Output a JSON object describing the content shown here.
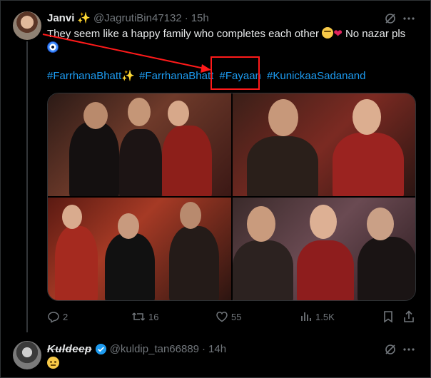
{
  "tweet": {
    "display_name": "Janvi",
    "name_emoji": "✨",
    "handle": "@JagrutiBin47132",
    "separator": "·",
    "time": "15h",
    "text": "They seem like a happy family who completes each other",
    "text_tail": "No nazar pls",
    "hashtags": [
      "#FarrhanaBhatt",
      "#FarrhanaBhatt",
      "#Fayaan",
      "#KunickaaSadanand"
    ],
    "highlighted_hashtag": "#Fayaan",
    "actions": {
      "replies": "2",
      "reposts": "16",
      "likes": "55",
      "views": "1.5K"
    }
  },
  "reply": {
    "display_name": "Kuldeep",
    "handle": "@kuldip_tan66889",
    "separator": "·",
    "time": "14h"
  },
  "colors": {
    "link": "#1d9bf0",
    "highlight_box": "#ff1a1a",
    "secondary_text": "#71767b",
    "verified": "#1d9bf0"
  },
  "icons": [
    "grok-icon",
    "more-icon",
    "reply-icon",
    "repost-icon",
    "like-icon",
    "views-icon",
    "bookmark-icon",
    "share-icon",
    "verified-badge-icon"
  ]
}
